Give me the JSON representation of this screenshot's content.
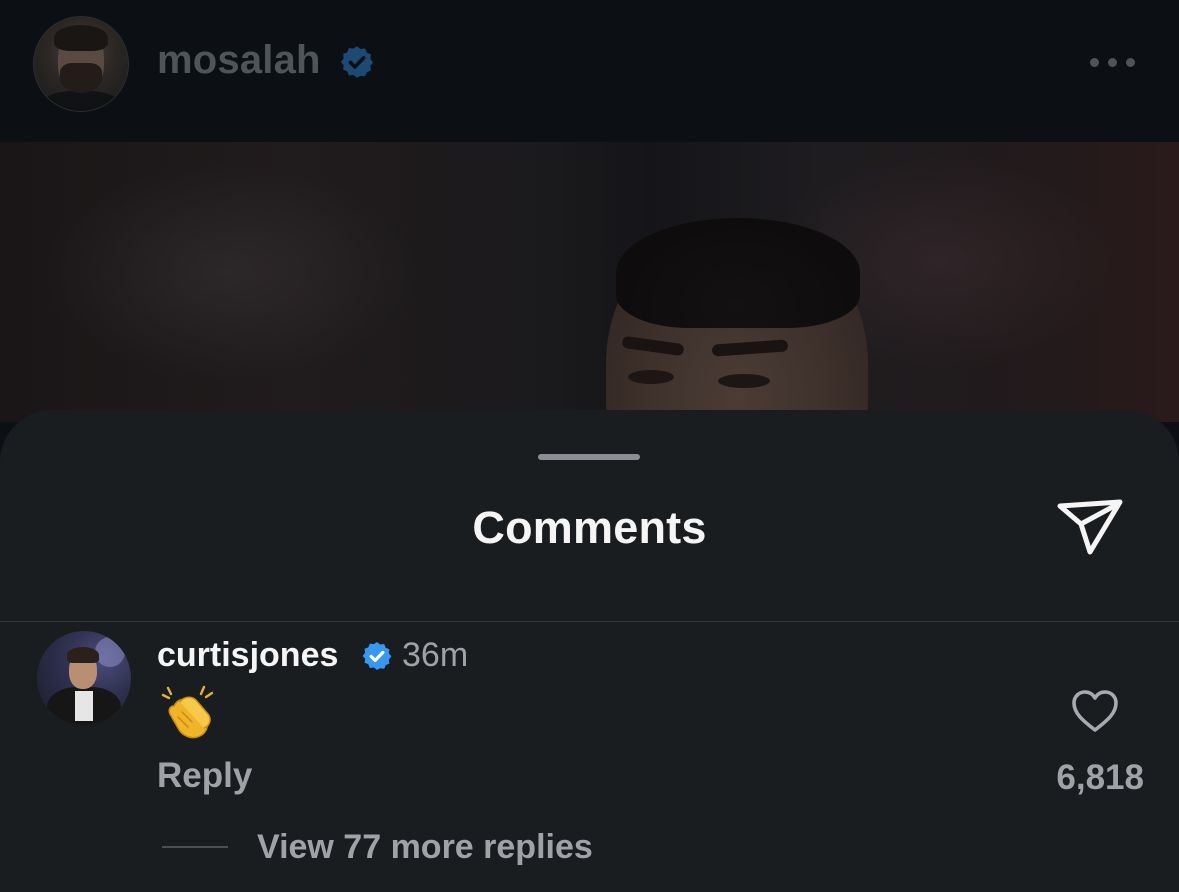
{
  "header": {
    "username": "mosalah",
    "verified": true,
    "more_icon": "ellipsis-icon"
  },
  "sheet": {
    "title": "Comments",
    "share_icon": "paper-plane-icon"
  },
  "comments": [
    {
      "username": "curtisjones",
      "verified": true,
      "time": "36m",
      "text_emoji": "clapping-hands",
      "reply_label": "Reply",
      "like_icon": "heart-outline-icon",
      "like_count": "6,818",
      "view_replies_label": "View 77 more replies"
    }
  ],
  "colors": {
    "verified_badge": "#3897f0",
    "header_verified_badge": "#1c4a73",
    "sheet_background": "#1a1d20",
    "muted_text": "#9fa3a8",
    "primary_text": "#f5f5f5"
  }
}
